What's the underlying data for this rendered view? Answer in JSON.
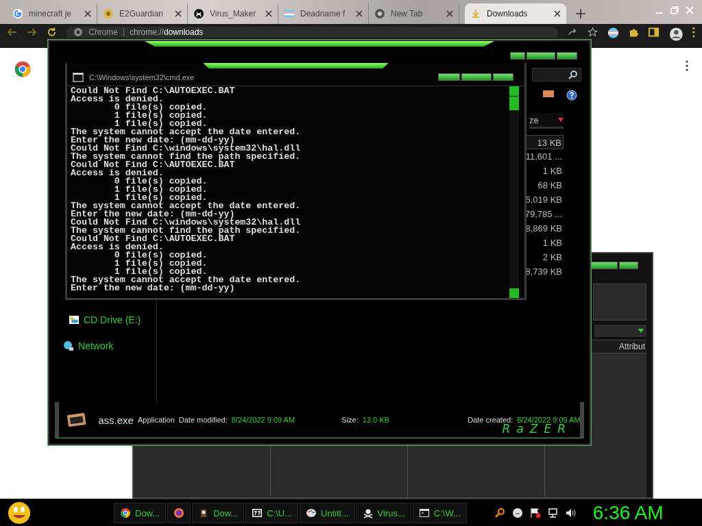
{
  "browser": {
    "tabs": [
      {
        "label": "minecraft je",
        "selected": false
      },
      {
        "label": "E2Guardian",
        "selected": false
      },
      {
        "label": "Virus_Maker",
        "selected": false
      },
      {
        "label": "Deadname f",
        "selected": false
      },
      {
        "label": "New Tab",
        "selected": false
      },
      {
        "label": "Downloads",
        "selected": true
      }
    ],
    "address": {
      "site": "Chrome",
      "url": "chrome://**downloads**"
    }
  },
  "explorer": {
    "size_header": "ze",
    "sizes": [
      {
        "text": "13 KB",
        "selected": true
      },
      {
        "text": "11,601 ...",
        "selected": false
      },
      {
        "text": "1 KB",
        "selected": false
      },
      {
        "text": "68 KB",
        "selected": false
      },
      {
        "text": "5,019 KB",
        "selected": false
      },
      {
        "text": "79,785 ...",
        "selected": false
      },
      {
        "text": "8,869 KB",
        "selected": false
      },
      {
        "text": "1 KB",
        "selected": false
      },
      {
        "text": "2 KB",
        "selected": false
      },
      {
        "text": "8,739 KB",
        "selected": false
      }
    ],
    "nav": [
      {
        "label": "CD Drive (E:)",
        "kind": "drive"
      },
      {
        "label": "Network",
        "kind": "network"
      }
    ],
    "details": {
      "name": "ass.exe",
      "type": "Application",
      "modified_label": "Date modified:",
      "modified": "8/24/2022 9:09 AM",
      "size_label": "Size:",
      "size": "13.0 KB",
      "created_label": "Date created:",
      "created": "8/24/2022 9:09 AM",
      "logo": "RaZER"
    }
  },
  "cmd": {
    "title": "C:\\Windows\\system32\\cmd.exe",
    "lines": [
      "Could Not Find C:\\AUTOEXEC.BAT",
      "Access is denied.",
      "        0 file(s) copied.",
      "        1 file(s) copied.",
      "        1 file(s) copied.",
      "The system cannot accept the date entered.",
      "Enter the new date: (mm-dd-yy)",
      "Could Not Find C:\\windows\\system32\\hal.dll",
      "The system cannot find the path specified.",
      "Could Not Find C:\\AUTOEXEC.BAT",
      "Access is denied.",
      "        0 file(s) copied.",
      "        1 file(s) copied.",
      "        1 file(s) copied.",
      "The system cannot accept the date entered.",
      "Enter the new date: (mm-dd-yy)",
      "Could Not Find C:\\windows\\system32\\hal.dll",
      "The system cannot find the path specified.",
      "Could Not Find C:\\AUTOEXEC.BAT",
      "Access is denied.",
      "        0 file(s) copied.",
      "        1 file(s) copied.",
      "        1 file(s) copied.",
      "The system cannot accept the date entered.",
      "Enter the new date: (mm-dd-yy)"
    ]
  },
  "back_window": {
    "column_header": "Attribut"
  },
  "taskbar": {
    "tasks": [
      {
        "label": "Dow..."
      },
      {
        "label": "Dow..."
      },
      {
        "label": "C:\\U..."
      },
      {
        "label": "Untitl..."
      },
      {
        "label": "Virus..."
      },
      {
        "label": "C:\\W..."
      }
    ],
    "clock": "6:36 AM"
  }
}
